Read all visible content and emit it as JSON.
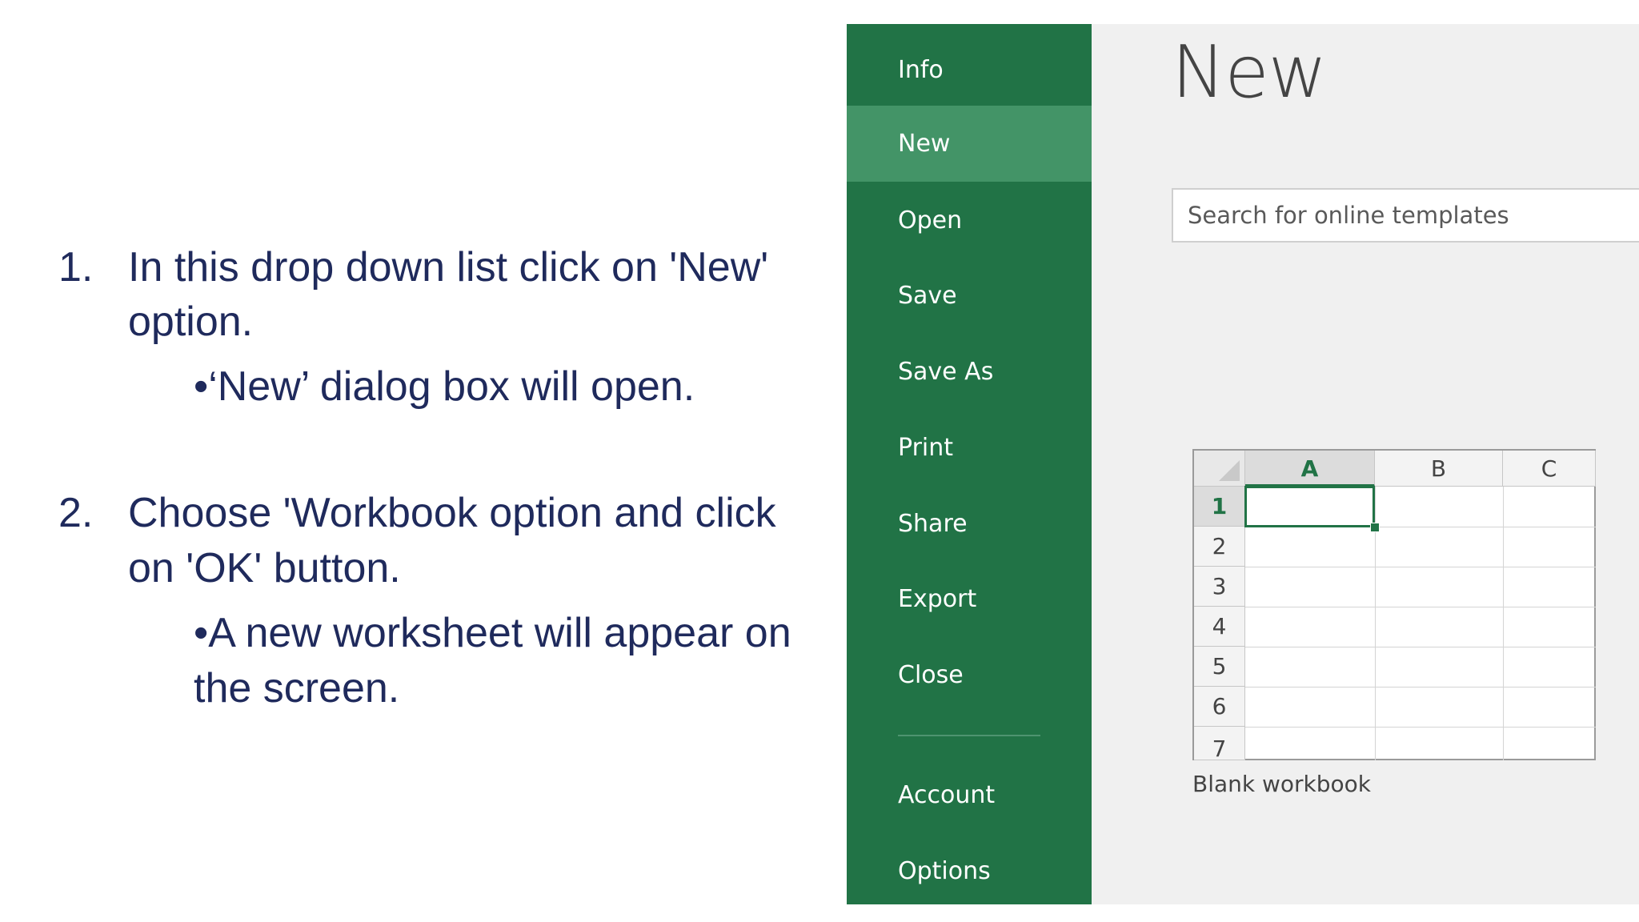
{
  "instructions": {
    "step1_num": "1.",
    "step1_line1": "In this drop down list click on 'New'",
    "step1_line2": "option.",
    "step1_bullet": "•‘New’ dialog box will open.",
    "step2_num": "2.",
    "step2_line1": "Choose 'Workbook option and click",
    "step2_line2": "on 'OK' button.",
    "step2_bullet_line1": "•A new worksheet will appear on",
    "step2_bullet_line2": "the screen."
  },
  "nav": {
    "items": [
      {
        "label": "Info"
      },
      {
        "label": "New"
      },
      {
        "label": "Open"
      },
      {
        "label": "Save"
      },
      {
        "label": "Save As"
      },
      {
        "label": "Print"
      },
      {
        "label": "Share"
      },
      {
        "label": "Export"
      },
      {
        "label": "Close"
      },
      {
        "label": "Account"
      },
      {
        "label": "Options"
      }
    ],
    "active_item": "New",
    "color": "#217346",
    "active_color": "#439467"
  },
  "main": {
    "title": "New",
    "search_placeholder": "Search for online templates",
    "template": {
      "label": "Blank workbook",
      "columns": [
        "A",
        "B",
        "C"
      ],
      "rows": [
        "1",
        "2",
        "3",
        "4",
        "5",
        "6",
        "7"
      ],
      "selected_cell": "A1"
    }
  }
}
